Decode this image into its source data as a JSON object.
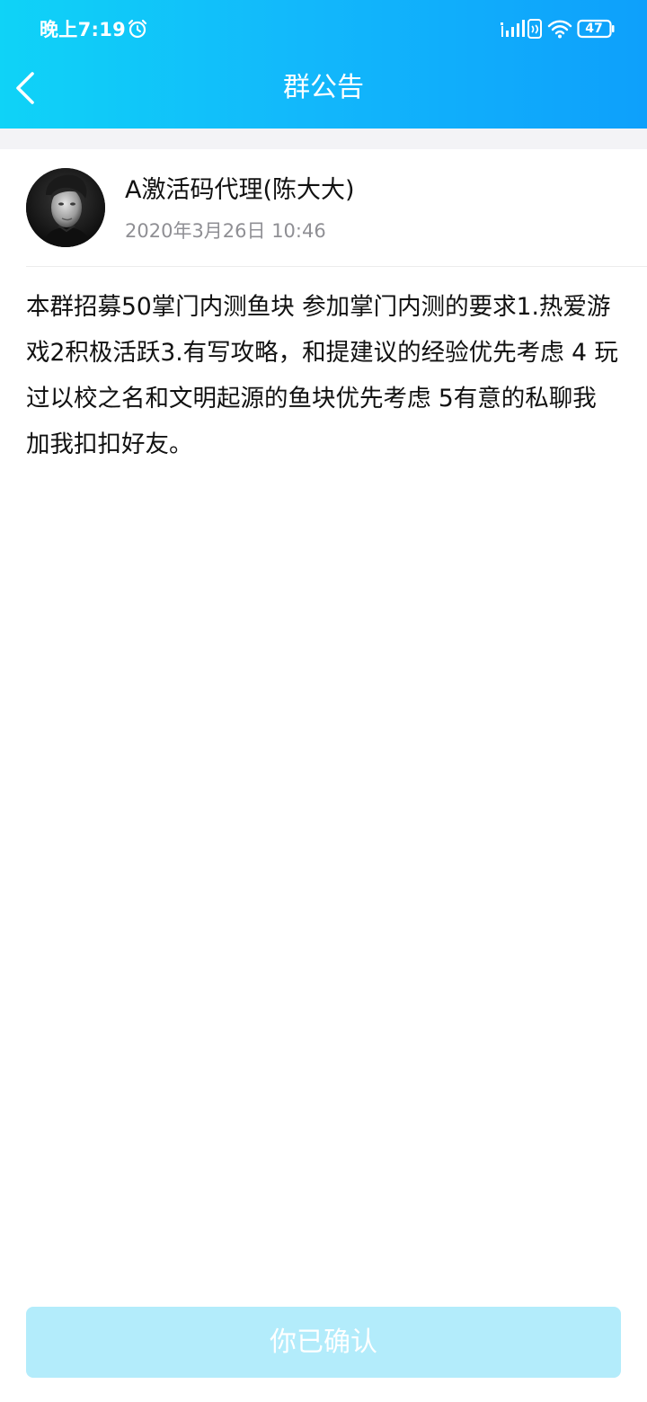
{
  "status_bar": {
    "time": "晚上7:19",
    "battery_level": "47",
    "icons": [
      "alarm-icon",
      "signal-icon",
      "nfc-icon",
      "wifi-icon",
      "battery-icon"
    ]
  },
  "header": {
    "title": "群公告",
    "back_icon": "chevron-left-icon",
    "gradient_colors": [
      "#0fd3f7",
      "#0ea0fb"
    ]
  },
  "announcement": {
    "poster_name": "A激活码代理(陈大大)",
    "posted_at": "2020年3月26日 10:46",
    "avatar": "black-and-white portrait photo",
    "body": "本群招募50掌门内测鱼块 参加掌门内测的要求1.热爱游戏2积极活跃3.有写攻略，和提建议的经验优先考虑 4 玩过以校之名和文明起源的鱼块优先考虑 5有意的私聊我 加我扣扣好友。"
  },
  "footer": {
    "confirm_label": "你已确认",
    "confirm_color": "#b3ecfb"
  }
}
